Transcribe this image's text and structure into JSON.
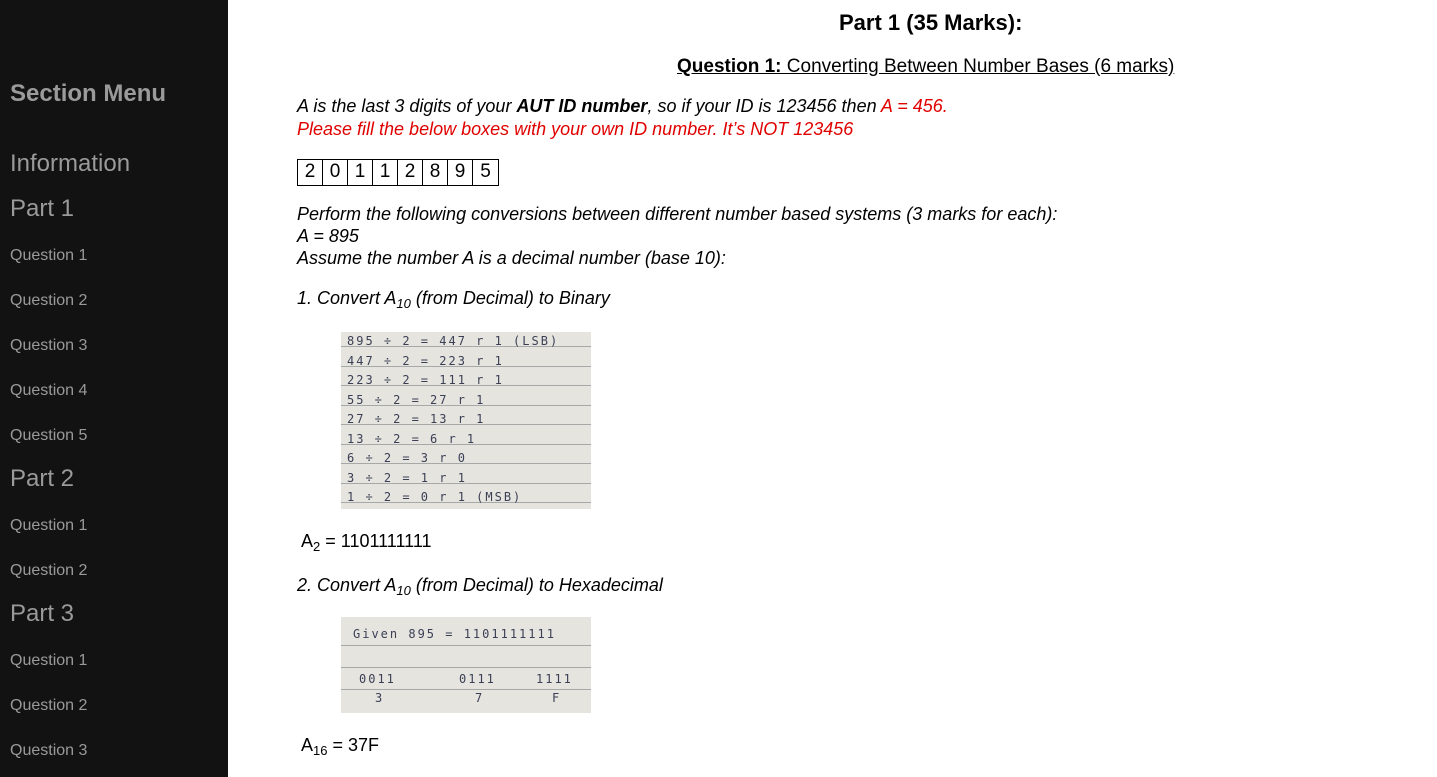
{
  "sidebar": {
    "title": "Section Menu",
    "items": [
      {
        "label": "Information",
        "size": "big"
      },
      {
        "label": "Part 1",
        "size": "big"
      },
      {
        "label": "Question 1",
        "size": "small"
      },
      {
        "label": "Question 2",
        "size": "small"
      },
      {
        "label": "Question 3",
        "size": "small"
      },
      {
        "label": "Question 4",
        "size": "small"
      },
      {
        "label": "Question 5",
        "size": "small"
      },
      {
        "label": "Part 2",
        "size": "big"
      },
      {
        "label": "Question 1",
        "size": "small"
      },
      {
        "label": "Question 2",
        "size": "small"
      },
      {
        "label": "Part 3",
        "size": "big"
      },
      {
        "label": "Question 1",
        "size": "small"
      },
      {
        "label": "Question 2",
        "size": "small"
      },
      {
        "label": "Question 3",
        "size": "small"
      }
    ]
  },
  "main": {
    "part_title": "Part 1 (35 Marks):",
    "question_title_bold": "Question 1:",
    "question_title_rest": " Converting Between Number Bases (6 marks)",
    "intro": {
      "pre": "A is the last 3 digits of your ",
      "bold": "AUT ID number",
      "mid": ", so if your ID is 123456 then ",
      "red_example": "A = 456.",
      "warning": "Please fill the below boxes with your own ID number. It’s NOT 123456"
    },
    "id_digits": [
      "2",
      "0",
      "1",
      "1",
      "2",
      "8",
      "9",
      "5"
    ],
    "instructions": {
      "line1": "Perform the following conversions between different number based systems (3 marks for each):",
      "line2": "A = 895",
      "line3": "Assume the number A is a decimal number (base 10):"
    },
    "task1": {
      "prefix": "1. Convert A",
      "sub": "10",
      "suffix": " (from Decimal) to Binary",
      "work_lines": [
        "895 ÷ 2 = 447 r 1   (LSB)",
        "447 ÷ 2 =  223 r 1",
        "223 ÷ 2 = 111  r 1",
        " 55 ÷ 2 = 27  r 1",
        " 27 ÷ 2 = 13 r 1",
        " 13 ÷ 2 = 6 r 1",
        "  6 ÷ 2 = 3 r 0",
        "  3 ÷ 2 = 1 r 1",
        "  1 ÷ 2 = 0 r 1   (MSB)"
      ],
      "answer_prefix": "A",
      "answer_sub": "2",
      "answer_value": " = 1101111111"
    },
    "task2": {
      "prefix": "2. Convert A",
      "sub": "10",
      "suffix": " (from Decimal) to Hexadecimal",
      "work_given": "Given  895 = 1101111111",
      "work_groups": [
        "0011",
        "0111",
        "1111"
      ],
      "work_hex": [
        "3",
        "7",
        "F"
      ],
      "answer_prefix": "A",
      "answer_sub": "16",
      "answer_value": " = 37F"
    }
  }
}
